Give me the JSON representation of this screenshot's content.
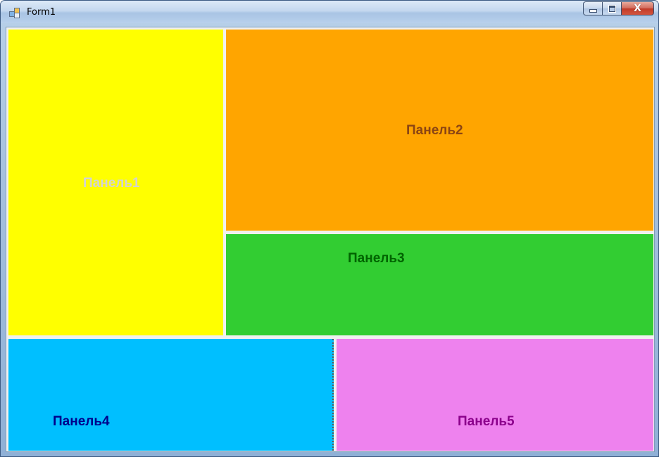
{
  "window": {
    "title": "Form1",
    "controls": {
      "minimize_icon": "minimize-icon",
      "maximize_icon": "maximize-icon",
      "close_icon": "close-icon",
      "close_glyph": "X"
    }
  },
  "panels": [
    {
      "label": "Панель1",
      "background": "#ffff00",
      "text_color": "#d3d3d3"
    },
    {
      "label": "Панель2",
      "background": "#ffa500",
      "text_color": "#8b4513"
    },
    {
      "label": "Панель3",
      "background": "#32cd32",
      "text_color": "#006400"
    },
    {
      "label": "Панель4",
      "background": "#00bfff",
      "text_color": "#00008b"
    },
    {
      "label": "Панель5",
      "background": "#ee82ee",
      "text_color": "#8b008b"
    }
  ]
}
